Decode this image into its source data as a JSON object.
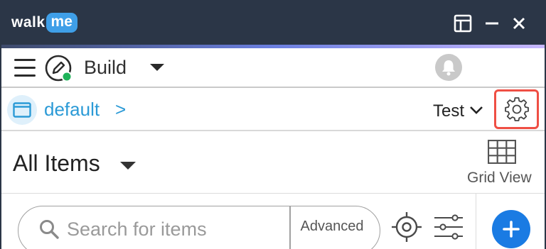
{
  "app": {
    "logo_walk": "walk",
    "logo_me": "me",
    "window_controls": [
      "layout-icon",
      "minimize-icon",
      "close-icon"
    ]
  },
  "toolbar": {
    "mode_label": "Build",
    "mode_icon": "pencil-circle-icon",
    "status_dot_color": "#1fb35a",
    "notifications_icon": "bell-icon"
  },
  "project": {
    "name": "default",
    "chevron": ">",
    "environment": "Test",
    "settings_icon": "gear-icon"
  },
  "section": {
    "title": "All Items",
    "view_label": "Grid View",
    "view_icon": "grid-icon"
  },
  "search": {
    "placeholder": "Search for items",
    "value": "",
    "advanced_label": "Advanced",
    "target_icon": "crosshair-icon",
    "filters_icon": "sliders-icon",
    "add_icon": "plus-icon"
  },
  "colors": {
    "titlebar": "#2b3647",
    "accent_blue": "#2b9ad6",
    "primary_button": "#1a7be3",
    "highlight_border": "#ef4f44"
  }
}
